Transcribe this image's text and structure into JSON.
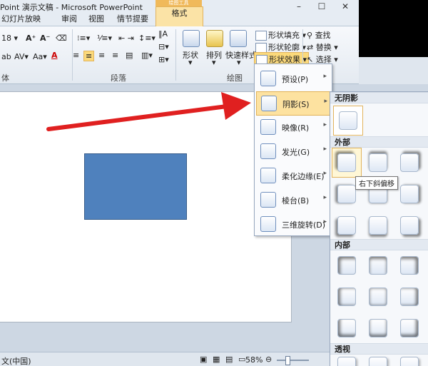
{
  "window": {
    "title": "Point 演示文稿 - Microsoft PowerPoint",
    "minimize": "–",
    "restore": "☐",
    "close": "✕"
  },
  "tabs": [
    "幻灯片放映",
    "审阅",
    "视图",
    "情节提要",
    "格式"
  ],
  "tools_badge": "绘图工具",
  "ribbon": {
    "font_size": "18",
    "groups": {
      "font": "体",
      "paragraph": "段落",
      "drawing": "绘图"
    },
    "buttons": {
      "shape": "形状",
      "arrange": "排列",
      "quick_styles": "快速样式",
      "shape_fill": "形状填充",
      "shape_outline": "形状轮廓",
      "shape_effects": "形状效果",
      "find": "查找",
      "replace": "替换",
      "select": "选择"
    }
  },
  "effects_menu": [
    {
      "label": "预设(P)",
      "active": false
    },
    {
      "label": "阴影(S)",
      "active": true
    },
    {
      "label": "映像(R)",
      "active": false
    },
    {
      "label": "发光(G)",
      "active": false
    },
    {
      "label": "柔化边缘(E)",
      "active": false
    },
    {
      "label": "棱台(B)",
      "active": false
    },
    {
      "label": "三维旋转(D)",
      "active": false
    }
  ],
  "shadow_gallery": {
    "no_shadow": "无阴影",
    "outer": "外部",
    "inner": "内部",
    "perspective": "透视"
  },
  "tooltip": "右下斜偏移",
  "status": {
    "language": "文(中国)",
    "zoom": "58%"
  },
  "colors": {
    "accent": "#fbd97a",
    "shape_fill": "#4f81bd",
    "arrow": "#e02020"
  }
}
